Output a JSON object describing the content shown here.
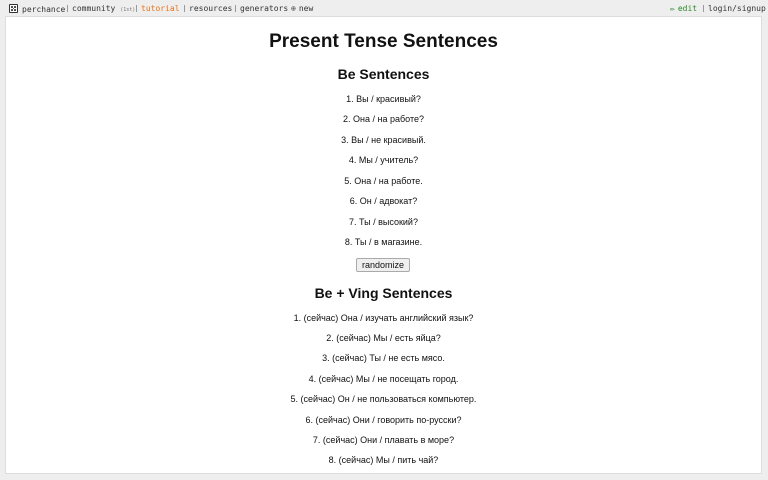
{
  "nav": {
    "brand": "perchance",
    "community": "community",
    "community_badge": "(1st)",
    "tutorial": "tutorial",
    "resources": "resources",
    "generators": "generators",
    "new": "new",
    "edit": "edit",
    "login": "login/signup"
  },
  "page": {
    "title": "Present Tense Sentences",
    "be_heading": "Be Sentences",
    "be_sentences": [
      "1. Вы / красивый?",
      "2. Она / на работе?",
      "3. Вы / не красивый.",
      "4. Мы / учитель?",
      "5. Она / на работе.",
      "6. Он / адвокат?",
      "7. Ты / высокий?",
      "8. Ты / в магазине."
    ],
    "randomize_label": "randomize",
    "ving_heading": "Be + Ving Sentences",
    "ving_sentences": [
      "1. (сейчас) Она / изучать английский язык?",
      "2. (сейчас) Мы / есть яйца?",
      "3. (сейчас) Ты / не есть мясо.",
      "4. (сейчас) Мы / не посещать город.",
      "5. (сейчас) Он / не пользоваться компьютер.",
      "6. (сейчас) Они / говорить по-русски?",
      "7. (сейчас) Они / плавать в море?",
      "8. (сейчас) Мы / пить чай?"
    ]
  }
}
